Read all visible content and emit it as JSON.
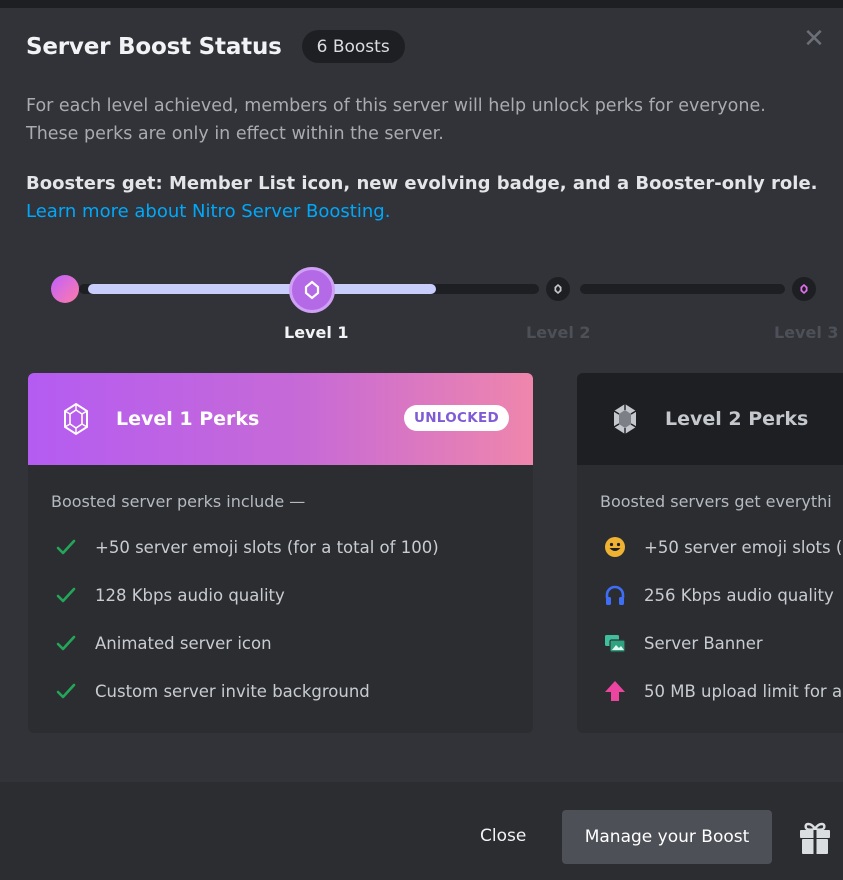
{
  "header": {
    "title": "Server Boost Status",
    "boost_count": "6 Boosts"
  },
  "description": {
    "line1": "For each level achieved, members of this server will help unlock perks for everyone.",
    "line2": "These perks are only in effect within the server."
  },
  "boosters": {
    "text": "Boosters get: Member List icon, new evolving badge, and a Booster-only role.",
    "link": "Learn more about Nitro Server Boosting."
  },
  "progress": {
    "levels": [
      "Level 1",
      "Level 2",
      "Level 3"
    ],
    "current_level": 1,
    "fill_fraction": 0.5
  },
  "cards": [
    {
      "title": "Level 1 Perks",
      "status": "UNLOCKED",
      "intro": "Boosted server perks include —",
      "perks": [
        {
          "icon": "check-icon",
          "text": "+50 server emoji slots (for a total of 100)"
        },
        {
          "icon": "check-icon",
          "text": "128 Kbps audio quality"
        },
        {
          "icon": "check-icon",
          "text": "Animated server icon"
        },
        {
          "icon": "check-icon",
          "text": "Custom server invite background"
        }
      ]
    },
    {
      "title": "Level 2 Perks",
      "intro": "Boosted servers get everythi",
      "perks": [
        {
          "icon": "smiley-icon",
          "text": "+50 server emoji slots ("
        },
        {
          "icon": "headphones-icon",
          "text": "256 Kbps audio quality"
        },
        {
          "icon": "banner-icon",
          "text": "Server Banner"
        },
        {
          "icon": "upload-arrow-icon",
          "text": "50 MB upload limit for a"
        }
      ]
    }
  ],
  "footer": {
    "close_label": "Close",
    "manage_label": "Manage your Boost"
  },
  "colors": {
    "accent_purple": "#b45cf2",
    "accent_pink": "#ef86ac",
    "link_blue": "#00a8fc",
    "check_green": "#23a55a"
  }
}
